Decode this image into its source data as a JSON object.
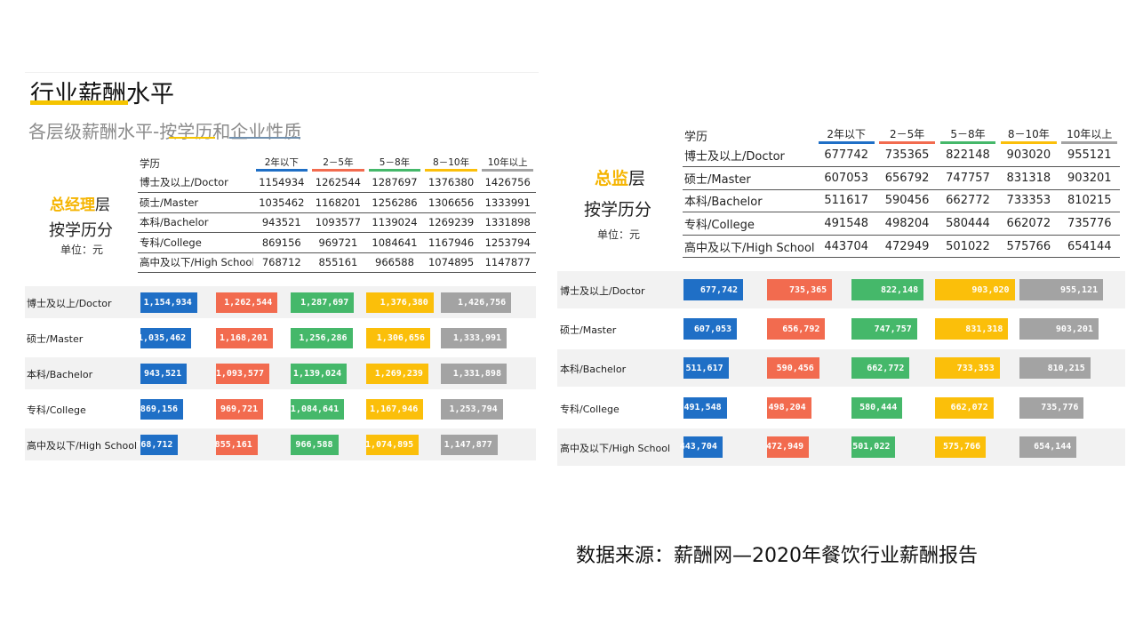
{
  "title": "行业薪酬水平",
  "subtitle": "各层级薪酬水平-按学历和企业性质",
  "source": "数据来源：薪酬网—2020年餐饮行业薪酬报告",
  "colors": [
    "#1f6fc6",
    "#f26b4f",
    "#45b86a",
    "#fbbf0a",
    "#a3a3a3"
  ],
  "chart_data": [
    {
      "type": "bar",
      "role_prefix": "总经理",
      "role_suffix": "层",
      "by_label": "按学历分",
      "unit_label": "单位：元",
      "header_label": "学历",
      "categories": [
        "博士及以上/Doctor",
        "硕士/Master",
        "本科/Bachelor",
        "专科/College",
        "高中及以下/High School"
      ],
      "series": [
        {
          "name": "2年以下",
          "values": [
            1154934,
            1035462,
            943521,
            869156,
            768712
          ]
        },
        {
          "name": "2－5年",
          "values": [
            1262544,
            1168201,
            1093577,
            969721,
            855161
          ]
        },
        {
          "name": "5－8年",
          "values": [
            1287697,
            1256286,
            1139024,
            1084641,
            966588
          ]
        },
        {
          "name": "8－10年",
          "values": [
            1376380,
            1306656,
            1269239,
            1167946,
            1074895
          ]
        },
        {
          "name": "10年以上",
          "values": [
            1426756,
            1333991,
            1331898,
            1253794,
            1147877
          ]
        }
      ]
    },
    {
      "type": "bar",
      "role_prefix": "总监",
      "role_suffix": "层",
      "by_label": "按学历分",
      "unit_label": "单位：元",
      "header_label": "学历",
      "categories": [
        "博士及以上/Doctor",
        "硕士/Master",
        "本科/Bachelor",
        "专科/College",
        "高中及以下/High School"
      ],
      "series": [
        {
          "name": "2年以下",
          "values": [
            677742,
            607053,
            511617,
            491548,
            443704
          ]
        },
        {
          "name": "2－5年",
          "values": [
            735365,
            656792,
            590456,
            498204,
            472949
          ]
        },
        {
          "name": "5－8年",
          "values": [
            822148,
            747757,
            662772,
            580444,
            501022
          ]
        },
        {
          "name": "8－10年",
          "values": [
            903020,
            831318,
            733353,
            662072,
            575766
          ]
        },
        {
          "name": "10年以上",
          "values": [
            955121,
            903201,
            810215,
            735776,
            654144
          ]
        }
      ]
    }
  ]
}
